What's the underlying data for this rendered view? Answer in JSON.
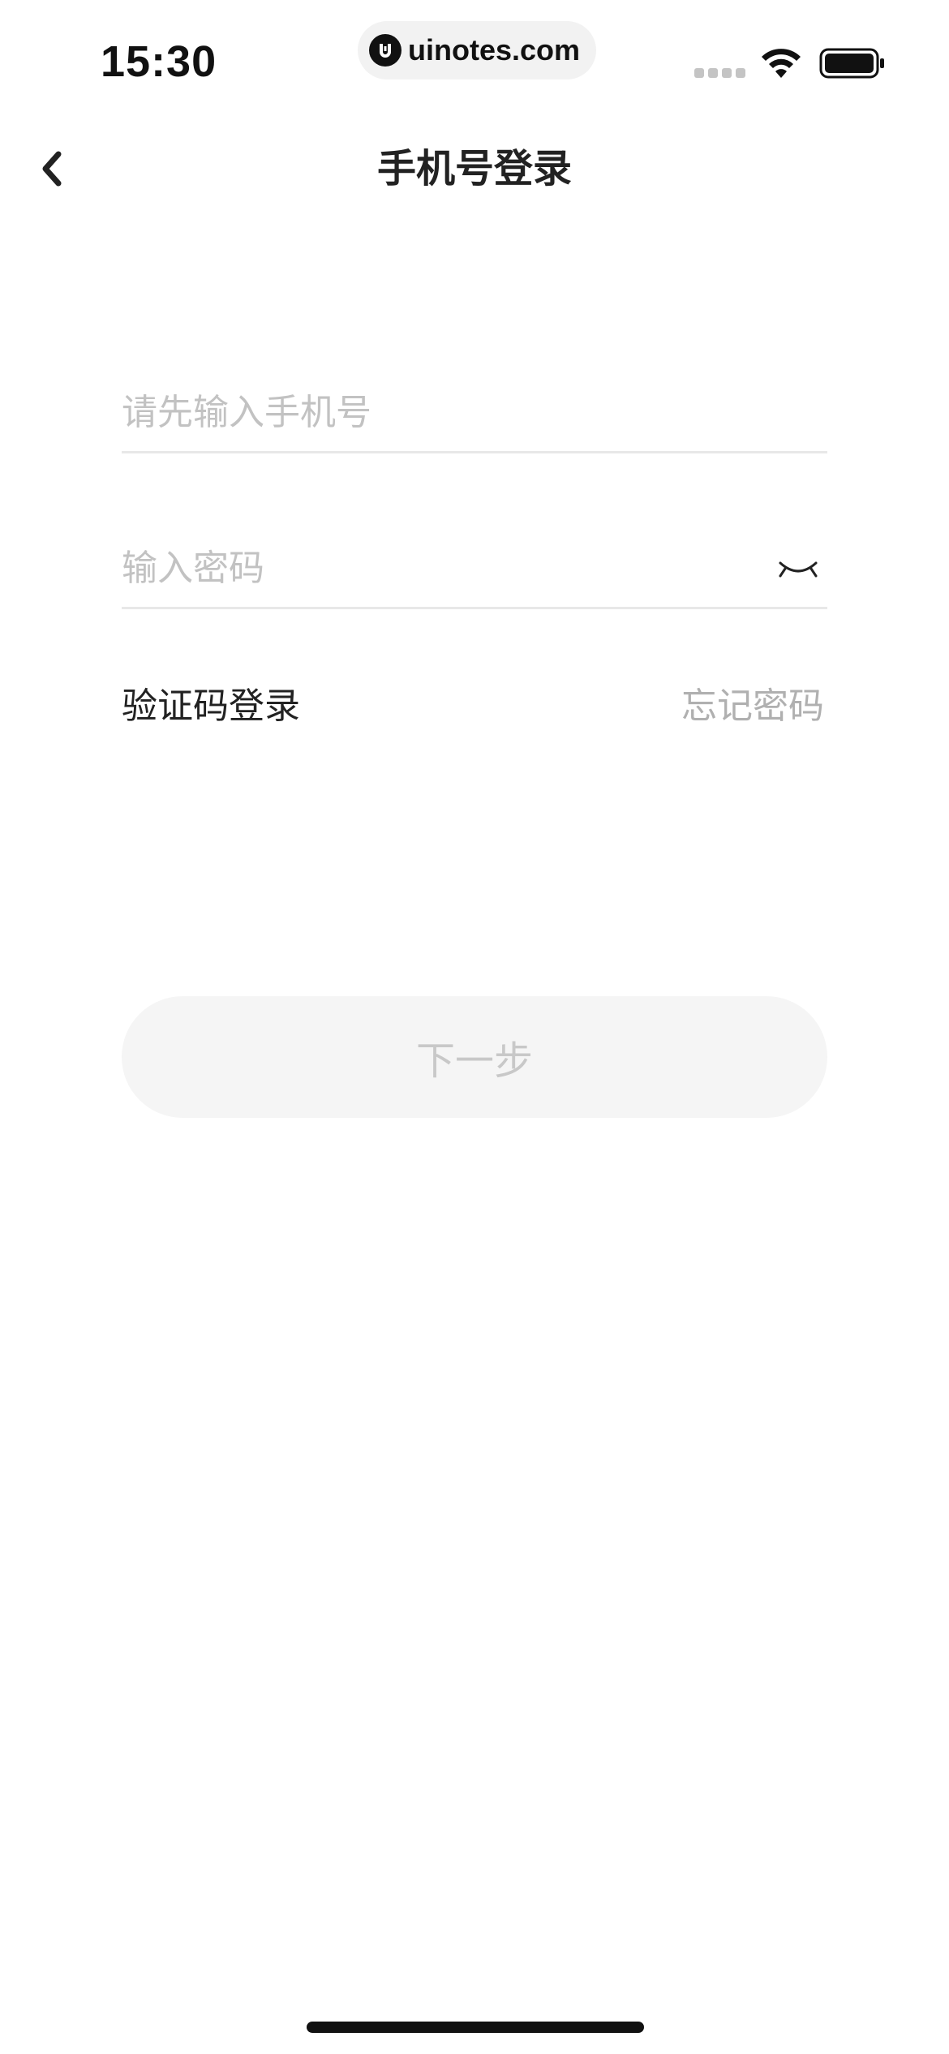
{
  "status_bar": {
    "time": "15:30",
    "url": "uinotes.com",
    "icons": [
      "signal-icon",
      "wifi-icon",
      "battery-icon"
    ]
  },
  "nav": {
    "back_icon": "chevron-left-icon",
    "title": "手机号登录"
  },
  "form": {
    "phone": {
      "value": "",
      "placeholder": "请先输入手机号"
    },
    "password": {
      "value": "",
      "placeholder": "输入密码",
      "toggle_icon": "eye-closed-icon"
    },
    "sms_login_label": "验证码登录",
    "forgot_password_label": "忘记密码",
    "next_label": "下一步"
  },
  "colors": {
    "background": "#ffffff",
    "text_primary": "#222222",
    "placeholder": "#c2c2c2",
    "divider": "#e8e8e8",
    "button_disabled_bg": "#f5f5f5",
    "button_disabled_text": "#c8c8c8"
  }
}
